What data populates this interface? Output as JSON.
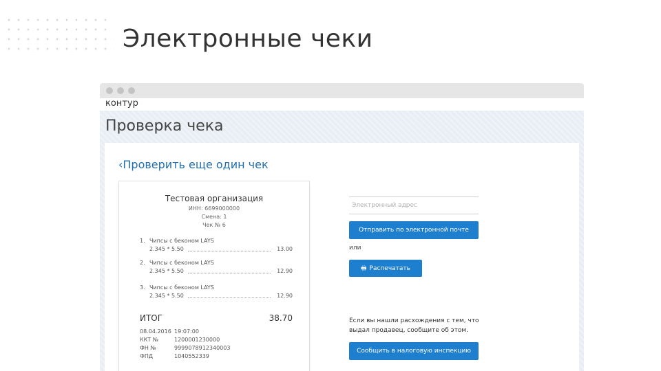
{
  "slide": {
    "title": "Электронные чеки"
  },
  "header": {
    "logo": "контур"
  },
  "page": {
    "heading": "Проверка чека",
    "back_link": "‹Проверить еще один чек"
  },
  "receipt": {
    "org": "Тестовая организация",
    "inn": "ИНН: 6699000000",
    "shift": "Смена: 1",
    "check": "Чек № 6",
    "items": [
      {
        "num": "1.",
        "name": "Чипсы с беконом LAYS",
        "qty": "2.345 * 5.50",
        "sum": "13.00"
      },
      {
        "num": "2.",
        "name": "Чипсы с беконом LAYS",
        "qty": "2.345 * 5.50",
        "sum": "12.90"
      },
      {
        "num": "3.",
        "name": "Чипсы с беконом LAYS",
        "qty": "2.345 * 5.50",
        "sum": "12.90"
      }
    ],
    "total_label": "ИТОГ",
    "total_value": "38.70",
    "meta": [
      {
        "label": "08.04.2016",
        "value": "19:07:00"
      },
      {
        "label": "ККТ №",
        "value": "1200001230000"
      },
      {
        "label": "ФН №",
        "value": "9999078912340003"
      },
      {
        "label": "ФПД",
        "value": "1040552339"
      }
    ]
  },
  "actions": {
    "email_placeholder": "Электронный адрес",
    "send_email": "Отправить по электронной почте",
    "or": "или",
    "print": "Распечатать",
    "print_icon": "printer-icon",
    "discrepancy": "Если вы нашли расхождения с тем, что выдал продавец, сообщите об этом.",
    "report": "Сообщить в налоговую инспекцию"
  },
  "colors": {
    "accent": "#1e7fcf",
    "link": "#1f6fb2",
    "page_bg": "#e8eef4"
  }
}
